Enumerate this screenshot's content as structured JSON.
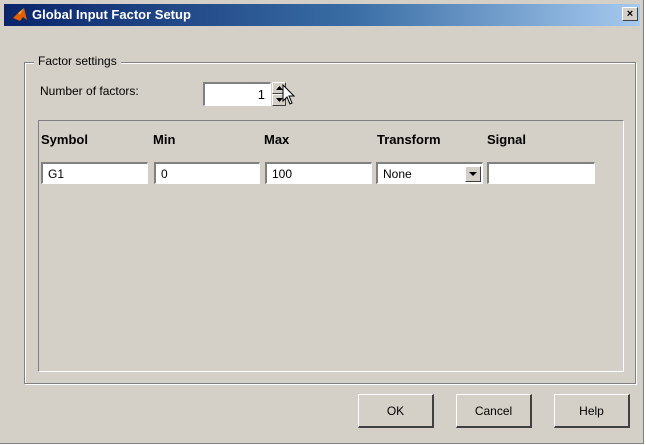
{
  "window": {
    "title": "Global Input Factor Setup",
    "close_label": "×"
  },
  "factor_settings": {
    "group_label": "Factor settings",
    "number_of_factors_label": "Number of factors:",
    "number_of_factors_value": "1"
  },
  "table": {
    "headers": [
      "Symbol",
      "Min",
      "Max",
      "Transform",
      "Signal"
    ],
    "rows": [
      {
        "symbol": "G1",
        "min": "0",
        "max": "100",
        "transform": "None",
        "signal": ""
      }
    ]
  },
  "buttons": {
    "ok": "OK",
    "cancel": "Cancel",
    "help": "Help"
  },
  "icons": [
    "matlab-logo-icon",
    "close-icon",
    "spinner-up-icon",
    "spinner-down-icon",
    "dropdown-arrow-icon",
    "mouse-cursor-icon"
  ]
}
